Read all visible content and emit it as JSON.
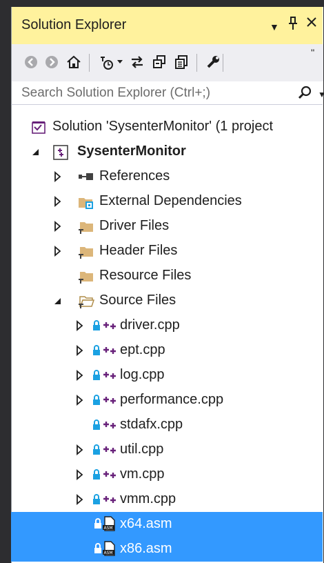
{
  "window": {
    "title": "Solution Explorer",
    "controls": [
      "dropdown",
      "pin",
      "close"
    ]
  },
  "toolbar": {
    "buttons": [
      "back-icon",
      "forward-icon",
      "home-icon",
      "pending-changes-filter-icon",
      "sync-icon",
      "collapse-all-icon",
      "show-all-files-icon",
      "properties-icon"
    ]
  },
  "search": {
    "placeholder": "Search Solution Explorer (Ctrl+;)"
  },
  "tree": {
    "solution": "Solution 'SysenterMonitor' (1 project",
    "project": "SysenterMonitor",
    "nodes": {
      "references": "References",
      "external": "External Dependencies",
      "driver_files": "Driver Files",
      "header_files": "Header Files",
      "resource_files": "Resource Files",
      "source_files": "Source Files"
    },
    "source_items": [
      "driver.cpp",
      "ept.cpp",
      "log.cpp",
      "performance.cpp",
      "stdafx.cpp",
      "util.cpp",
      "vm.cpp",
      "vmm.cpp",
      "x64.asm",
      "x86.asm"
    ]
  },
  "colors": {
    "title_bar": "#fff29d",
    "selection": "#3399ff",
    "cpp_icon": "#68217a",
    "lock_icon": "#1ba1e2",
    "folder": "#dcb67a"
  }
}
